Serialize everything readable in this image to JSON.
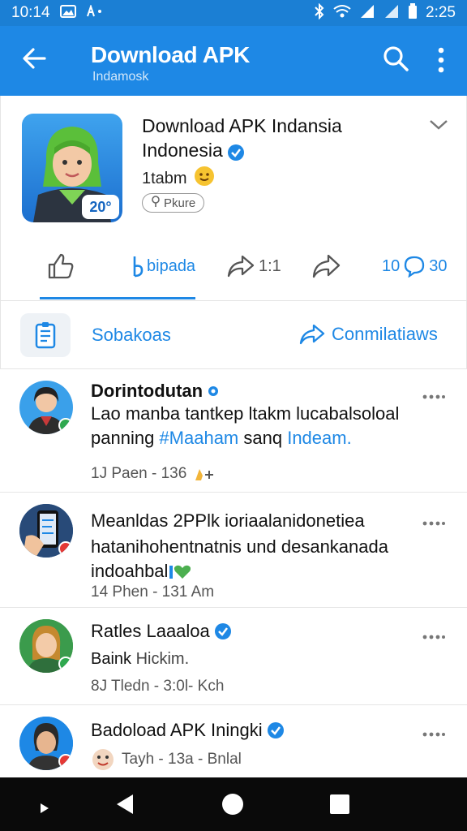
{
  "statusbar": {
    "time": "10:14",
    "clock": "2:25"
  },
  "appbar": {
    "title": "Download APK",
    "subtitle": "Indamosk"
  },
  "app": {
    "name": "Download APK Indansia",
    "developer": "Indonesia",
    "size": "1tabm",
    "chip": "Pkure",
    "icon_badge": "20°"
  },
  "actions": {
    "tab_label": "bipada",
    "share_count": "1:1",
    "comments_count": "10",
    "comments_count2": "30"
  },
  "tools": {
    "doc_label": "Sobakoas",
    "share_label": "Conmilatiaws"
  },
  "posts": [
    {
      "name": "Dorintodutan",
      "text_1": "Lao manba tantkep ltakm lucabalsoloal",
      "text_2a": "panning ",
      "text_2b": "#Maaham",
      "text_2c": " sanq ",
      "text_2d": "Indeam.",
      "meta": "1J Paen - 136"
    },
    {
      "name": "Meanldas 2PPlk ioriaalanidonetiea",
      "text_1": "hatanihohentnatnis und desankanada",
      "text_2a": "indoahbal",
      "meta": "14 Phen - 131 Am"
    },
    {
      "name": "Ratles Laaaloa",
      "text_1a": "Baink",
      "text_1b": " Hickim.",
      "meta": "8J Tledn - 3:0l- Kch"
    },
    {
      "name": "Badoload APK Iningki",
      "meta": "Tayh - 13a - Bnlal"
    }
  ],
  "colors": {
    "primary": "#1e88e5",
    "status": "#1b7fd4"
  }
}
